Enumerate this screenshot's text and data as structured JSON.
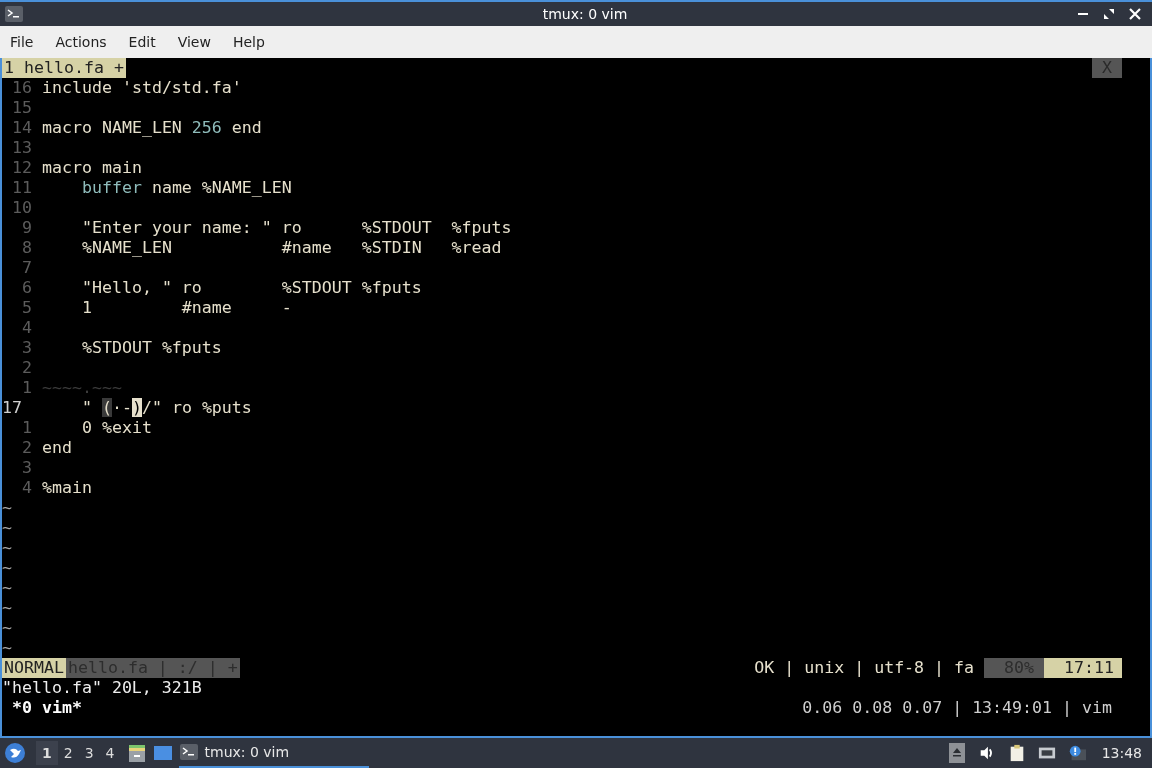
{
  "window": {
    "title": "tmux: 0 vim"
  },
  "menu": [
    "File",
    "Actions",
    "Edit",
    "View",
    "Help"
  ],
  "tmux_tabs": [
    {
      "label": "1 hello.fa +",
      "selected": true
    }
  ],
  "tmux_close": "X",
  "lines": [
    {
      "number": "16",
      "current": false,
      "segments": [
        {
          "text": "include 'std/std.fa'",
          "kind": "plain"
        }
      ]
    },
    {
      "number": "15",
      "current": false
    },
    {
      "number": "14",
      "current": false,
      "segments": [
        {
          "text": "macro NAME_LEN ",
          "kind": "plain"
        },
        {
          "text": "256",
          "kind": "accent"
        },
        {
          "text": " end",
          "kind": "plain"
        }
      ]
    },
    {
      "number": "13",
      "current": false
    },
    {
      "number": "12",
      "current": false,
      "segments": [
        {
          "text": "macro main",
          "kind": "plain"
        }
      ]
    },
    {
      "number": "11",
      "current": false,
      "segments": [
        {
          "text": "    buffer",
          "kind": "accent"
        },
        {
          "text": " name %NAME_LEN",
          "kind": "plain"
        }
      ]
    },
    {
      "number": "10",
      "current": false
    },
    {
      "number": "9",
      "current": false,
      "segments": [
        {
          "text": "    \"Enter your name: \" ro      %STDOUT  %fputs",
          "kind": "plain"
        }
      ]
    },
    {
      "number": "8",
      "current": false,
      "segments": [
        {
          "text": "    %NAME_LEN           #name   %STDIN   %read",
          "kind": "plain"
        }
      ]
    },
    {
      "number": "7",
      "current": false
    },
    {
      "number": "6",
      "current": false,
      "segments": [
        {
          "text": "    \"Hello, \" ro        %STDOUT %fputs",
          "kind": "plain"
        }
      ]
    },
    {
      "number": "5",
      "current": false,
      "segments": [
        {
          "text": "    1         #name     -",
          "kind": "plain"
        }
      ]
    },
    {
      "number": "4",
      "current": false
    },
    {
      "number": "3",
      "current": false,
      "segments": [
        {
          "text": "    %STDOUT %fputs",
          "kind": "plain"
        }
      ]
    },
    {
      "number": "2",
      "current": false
    },
    {
      "number": "1",
      "current": false,
      "segments": [
        {
          "text": "~~~~.~~~",
          "kind": "dim"
        }
      ]
    },
    {
      "number": "17",
      "current": true,
      "segments": [
        {
          "text": "    \" ",
          "kind": "plain"
        },
        {
          "text": "(",
          "kind": "match"
        },
        {
          "text": "·-",
          "kind": "plain"
        },
        {
          "text": ")",
          "kind": "cursor"
        },
        {
          "text": "/\" ro %puts",
          "kind": "plain"
        }
      ]
    },
    {
      "number": "1",
      "current": false,
      "segments": [
        {
          "text": "    0 %exit",
          "kind": "plain"
        }
      ]
    },
    {
      "number": "2",
      "current": false,
      "segments": [
        {
          "text": "end",
          "kind": "plain"
        }
      ]
    },
    {
      "number": "3",
      "current": false
    },
    {
      "number": "4",
      "current": false,
      "segments": [
        {
          "text": "%main",
          "kind": "plain"
        }
      ]
    }
  ],
  "empty_lines": [
    "~",
    "~",
    "~",
    "~",
    "~",
    "~",
    "~",
    "~"
  ],
  "statusline": {
    "mode": "NORMAL",
    "file": "hello.fa | :/ | +",
    "info": "OK | unix | utf-8 | fa",
    "percent": "80%",
    "position": "17:11"
  },
  "message": "\"hello.fa\" 20L, 321B",
  "tmux_status": {
    "window": "*0 vim*",
    "right": "0.06 0.08 0.07 | 13:49:01 | vim"
  },
  "taskbar": {
    "workspaces": [
      {
        "label": "1",
        "selected": true
      },
      {
        "label": "2",
        "selected": false
      },
      {
        "label": "3",
        "selected": false
      },
      {
        "label": "4",
        "selected": false
      }
    ],
    "task": "tmux: 0 vim",
    "clock": "13:48"
  }
}
